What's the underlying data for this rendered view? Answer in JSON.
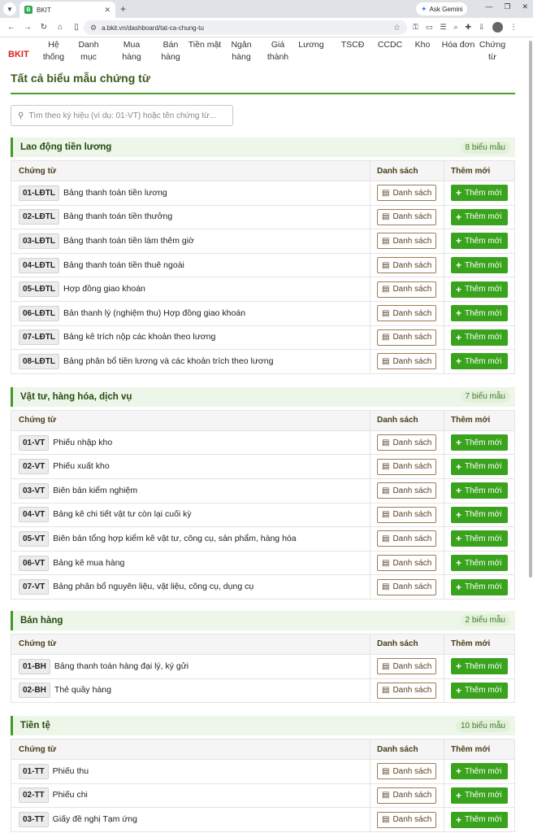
{
  "browser": {
    "tab_title": "BKIT",
    "favicon_letter": "B",
    "url": "a.bkit.vn/dashboard/tat-ca-chung-tu",
    "gemini_label": "Ask Gemini"
  },
  "app": {
    "logo": "BKIT",
    "menu": [
      "Hệ thống",
      "Danh mục",
      "Mua hàng",
      "Bán hàng",
      "Tiền mặt",
      "Ngân hàng",
      "Giá thành",
      "Lương",
      "TSCĐ",
      "CCDC",
      "Kho",
      "Hóa đơn",
      "Chứng từ"
    ]
  },
  "page": {
    "title": "Tất cả biểu mẫu chứng từ",
    "search_placeholder": "Tìm theo ký hiệu (ví dụ: 01-VT) hoặc tên chứng từ..."
  },
  "table_headers": {
    "doc": "Chứng từ",
    "list": "Danh sách",
    "add": "Thêm mới"
  },
  "buttons": {
    "list": "Danh sách",
    "add": "Thêm mới"
  },
  "sections": [
    {
      "title": "Lao động tiền lương",
      "count": "8 biểu mẫu",
      "rows": [
        {
          "code": "01-LĐTL",
          "name": "Bảng thanh toán tiền lương"
        },
        {
          "code": "02-LĐTL",
          "name": "Bảng thanh toán tiền thưởng"
        },
        {
          "code": "03-LĐTL",
          "name": "Bảng thanh toán tiền làm thêm giờ"
        },
        {
          "code": "04-LĐTL",
          "name": "Bảng thanh toán tiền thuê ngoài"
        },
        {
          "code": "05-LĐTL",
          "name": "Hợp đồng giao khoán"
        },
        {
          "code": "06-LĐTL",
          "name": "Bản thanh lý (nghiệm thu) Hợp đồng giao khoán"
        },
        {
          "code": "07-LĐTL",
          "name": "Bảng kê trích nộp các khoản theo lương"
        },
        {
          "code": "08-LĐTL",
          "name": "Bảng phân bổ tiền lương và các khoản trích theo lương"
        }
      ]
    },
    {
      "title": "Vật tư, hàng hóa, dịch vụ",
      "count": "7 biểu mẫu",
      "rows": [
        {
          "code": "01-VT",
          "name": "Phiếu nhập kho"
        },
        {
          "code": "02-VT",
          "name": "Phiếu xuất kho"
        },
        {
          "code": "03-VT",
          "name": "Biên bản kiểm nghiệm"
        },
        {
          "code": "04-VT",
          "name": "Bảng kê chi tiết vật tư còn lại cuối kỳ"
        },
        {
          "code": "05-VT",
          "name": "Biên bản tổng hợp kiểm kê vật tư, công cụ, sản phẩm, hàng hóa"
        },
        {
          "code": "06-VT",
          "name": "Bảng kê mua hàng"
        },
        {
          "code": "07-VT",
          "name": "Bảng phân bổ nguyên liệu, vật liệu, công cụ, dụng cụ"
        }
      ]
    },
    {
      "title": "Bán hàng",
      "count": "2 biểu mẫu",
      "rows": [
        {
          "code": "01-BH",
          "name": "Bảng thanh toán hàng đại lý, ký gửi"
        },
        {
          "code": "02-BH",
          "name": "Thẻ quầy hàng"
        }
      ]
    },
    {
      "title": "Tiền tệ",
      "count": "10 biểu mẫu",
      "rows": [
        {
          "code": "01-TT",
          "name": "Phiếu thu"
        },
        {
          "code": "02-TT",
          "name": "Phiếu chi"
        },
        {
          "code": "03-TT",
          "name": "Giấy đề nghị Tạm ứng"
        }
      ]
    }
  ]
}
